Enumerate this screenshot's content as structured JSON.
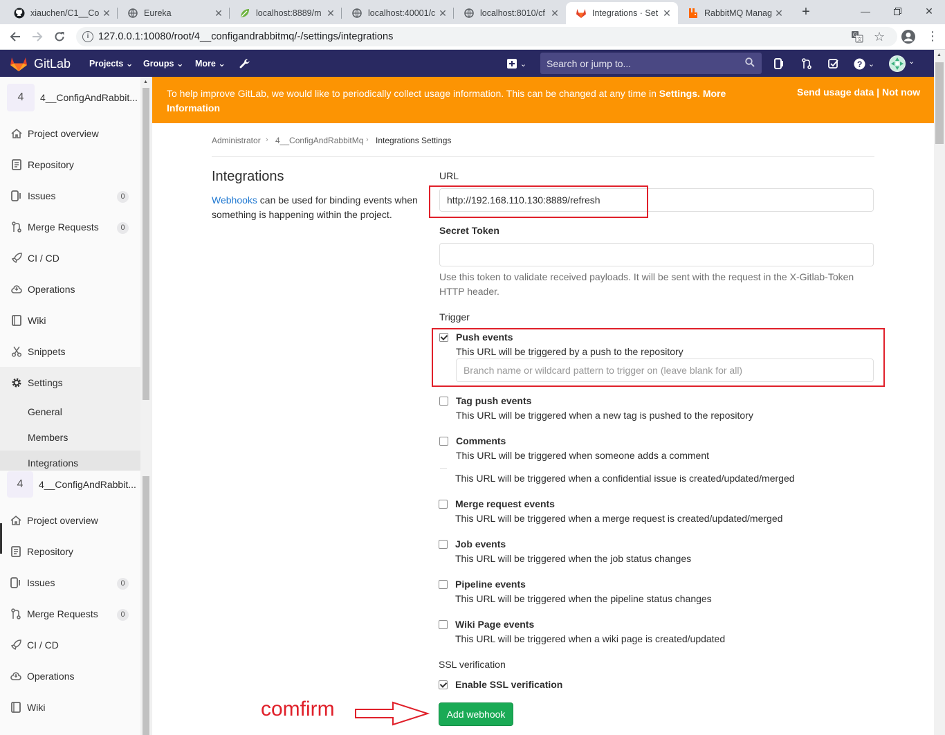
{
  "browser": {
    "tabs": [
      {
        "title": "xiauchen/C1__Co",
        "icon": "github-icon"
      },
      {
        "title": "Eureka",
        "icon": "globe-icon"
      },
      {
        "title": "localhost:8889/m",
        "icon": "spring-leaf-icon"
      },
      {
        "title": "localhost:40001/c",
        "icon": "globe-icon"
      },
      {
        "title": "localhost:8010/cf",
        "icon": "globe-icon"
      },
      {
        "title": "Integrations · Set",
        "icon": "gitlab-icon",
        "active": true
      },
      {
        "title": "RabbitMQ Manag",
        "icon": "rabbitmq-icon"
      }
    ],
    "url": "127.0.0.1:10080/root/4__configandrabbitmq/-/settings/integrations"
  },
  "gitlab_header": {
    "brand": "GitLab",
    "nav": [
      "Projects",
      "Groups",
      "More"
    ],
    "search_placeholder": "Search or jump to..."
  },
  "sidebar": {
    "project_avatar": "4",
    "project_name": "4__ConfigAndRabbit...",
    "items": [
      {
        "label": "Project overview",
        "icon": "home-icon"
      },
      {
        "label": "Repository",
        "icon": "doc-icon"
      },
      {
        "label": "Issues",
        "icon": "issues-icon",
        "count": "0"
      },
      {
        "label": "Merge Requests",
        "icon": "merge-icon",
        "count": "0"
      },
      {
        "label": "CI / CD",
        "icon": "rocket-icon"
      },
      {
        "label": "Operations",
        "icon": "cloud-icon"
      },
      {
        "label": "Wiki",
        "icon": "book-icon"
      },
      {
        "label": "Snippets",
        "icon": "scissors-icon"
      },
      {
        "label": "Settings",
        "icon": "gear-icon"
      }
    ],
    "settings_sub": [
      "General",
      "Members",
      "Integrations"
    ]
  },
  "banner": {
    "message": "To help improve GitLab, we would like to periodically collect usage information. This can be changed at any time in",
    "settings_link": "Settings",
    "more_info_link": "More Information",
    "send_usage": "Send usage data",
    "divider": "|",
    "not_now": "Not now"
  },
  "breadcrumb": [
    "Administrator",
    "4__ConfigAndRabbitMq",
    "Integrations Settings"
  ],
  "integrations": {
    "title": "Integrations",
    "webhooks_link": "Webhooks",
    "description_rest": " can be used for binding events when something is happening within the project."
  },
  "form": {
    "url_label": "URL",
    "url_value": "http://192.168.110.130:8889/refresh",
    "secret_label": "Secret Token",
    "secret_value": "",
    "secret_help": "Use this token to validate received payloads. It will be sent with the request in the X-Gitlab-Token HTTP header.",
    "trigger_label": "Trigger",
    "branch_placeholder": "Branch name or wildcard pattern to trigger on (leave blank for all)",
    "events": [
      {
        "name": "Push events",
        "desc": "This URL will be triggered by a push to the repository",
        "checked": true
      },
      {
        "name": "Tag push events",
        "desc": "This URL will be triggered when a new tag is pushed to the repository",
        "checked": false
      },
      {
        "name": "Comments",
        "desc": "This URL will be triggered when someone adds a comment",
        "checked": false
      },
      {
        "name": "",
        "desc": "This URL will be triggered when a confidential issue is created/updated/merged",
        "checked": false
      },
      {
        "name": "Merge request events",
        "desc": "This URL will be triggered when a merge request is created/updated/merged",
        "checked": false
      },
      {
        "name": "Job events",
        "desc": "This URL will be triggered when the job status changes",
        "checked": false
      },
      {
        "name": "Pipeline events",
        "desc": "This URL will be triggered when the pipeline status changes",
        "checked": false
      },
      {
        "name": "Wiki Page events",
        "desc": "This URL will be triggered when a wiki page is created/updated",
        "checked": false
      }
    ],
    "ssl_label": "SSL verification",
    "ssl_option": "Enable SSL verification",
    "ssl_checked": true,
    "submit_label": "Add webhook"
  },
  "annotation": {
    "text": "comfirm",
    "color": "#e0202a"
  },
  "colors": {
    "header_bg": "#292961",
    "banner_bg": "#fc9403",
    "button_green": "#1aaa55",
    "link_blue": "#1f78d1"
  }
}
